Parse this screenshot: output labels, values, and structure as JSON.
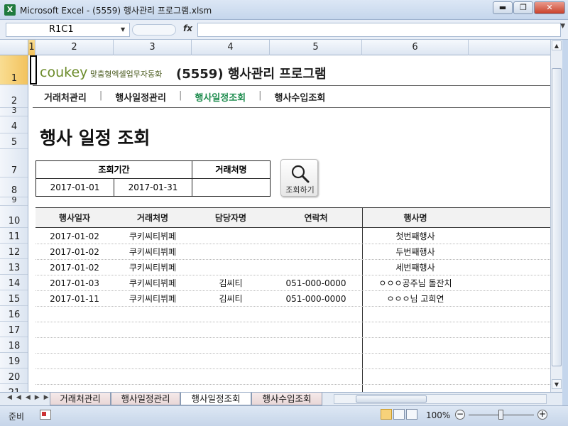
{
  "window": {
    "title": "Microsoft Excel - (5559) 행사관리 프로그램.xlsm",
    "app_icon": "X",
    "minimize": "▬",
    "restore": "❐",
    "close": "✕"
  },
  "formula_bar": {
    "name_box": "R1C1",
    "fx": "fx",
    "value": ""
  },
  "columns": [
    "1",
    "2",
    "3",
    "4",
    "5",
    "6"
  ],
  "rows": [
    "1",
    "2",
    "3",
    "4",
    "5",
    "7",
    "8",
    "9",
    "10",
    "11",
    "12",
    "13",
    "14",
    "15",
    "16",
    "17",
    "18",
    "19",
    "20",
    "21"
  ],
  "sheet": {
    "logo": "coukey",
    "logo_sub": "맞춤형엑셀업무자동화",
    "doc_title": "(5559) 행사관리 프로그램",
    "menu": [
      "거래처관리",
      "행사일정관리",
      "행사일정조회",
      "행사수입조회"
    ],
    "menu_separator": "|",
    "page_title": "행사 일정 조회",
    "query": {
      "period_label": "조회기간",
      "client_label": "거래처명",
      "start_date": "2017-01-01",
      "end_date": "2017-01-31",
      "client_value": ""
    },
    "search_button": "조회하기",
    "table": {
      "headers": [
        "행사일자",
        "거래처명",
        "담당자명",
        "연락처",
        "행사명"
      ],
      "rows": [
        [
          "2017-01-02",
          "쿠키씨티뷔페",
          "",
          "",
          "첫번째행사"
        ],
        [
          "2017-01-02",
          "쿠키씨티뷔페",
          "",
          "",
          "두번째행사"
        ],
        [
          "2017-01-02",
          "쿠키씨티뷔페",
          "",
          "",
          "세번째행사"
        ],
        [
          "2017-01-03",
          "쿠키씨티뷔페",
          "김씨티",
          "051-000-0000",
          "ㅇㅇㅇ공주님 돌잔치"
        ],
        [
          "2017-01-11",
          "쿠키씨티뷔페",
          "김씨티",
          "051-000-0000",
          "ㅇㅇㅇ님 고희연"
        ],
        [
          "",
          "",
          "",
          "",
          ""
        ],
        [
          "",
          "",
          "",
          "",
          ""
        ],
        [
          "",
          "",
          "",
          "",
          ""
        ],
        [
          "",
          "",
          "",
          "",
          ""
        ],
        [
          "",
          "",
          "",
          "",
          ""
        ]
      ]
    }
  },
  "tabs": [
    "거래처관리",
    "행사일정관리",
    "행사일정조회",
    "행사수입조회"
  ],
  "active_tab": "행사일정조회",
  "status": {
    "ready": "준비",
    "zoom": "100%",
    "zoom_minus": "−",
    "zoom_plus": "+"
  },
  "colors": {
    "active_menu": "#1e8c4e",
    "logo": "#6b8b2a",
    "selection_header": "#f2c25c"
  }
}
